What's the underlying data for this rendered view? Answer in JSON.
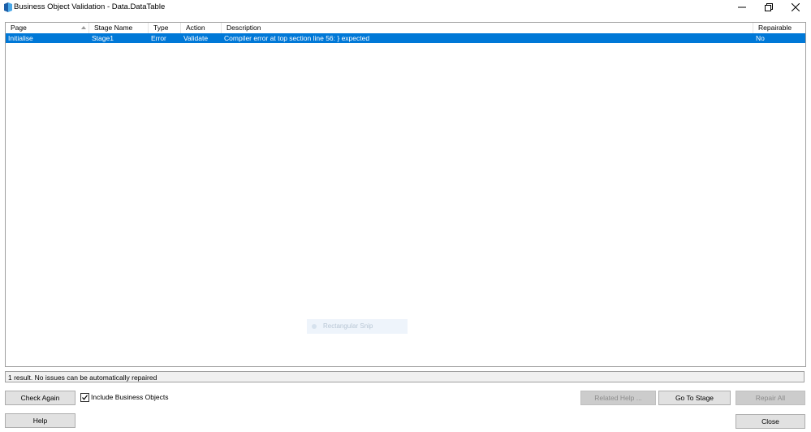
{
  "window": {
    "title": "Business Object Validation - Data.DataTable",
    "icons": {
      "app": "app-logo-icon",
      "minimize": "minimize-icon",
      "maximize": "restore-icon",
      "close": "close-icon"
    }
  },
  "table": {
    "columns": [
      "Page",
      "Stage Name",
      "Type",
      "Action",
      "Description",
      "Repairable"
    ],
    "rows": [
      {
        "page": "Initialise",
        "stage_name": "Stage1",
        "type": "Error",
        "action": "Validate",
        "description": "Compiler error at top section line 56: } expected",
        "repairable": "No"
      }
    ],
    "selected_color": "#0078d7"
  },
  "overlay": {
    "label": "Rectangular Snip"
  },
  "status": {
    "text": "1 result. No issues can be automatically repaired"
  },
  "controls": {
    "check_again": "Check Again",
    "include_business_objects": "Include Business Objects",
    "include_checked": true,
    "related_help": "Related Help ...",
    "go_to_stage": "Go To Stage",
    "repair_all": "Repair All",
    "help": "Help",
    "close": "Close"
  }
}
